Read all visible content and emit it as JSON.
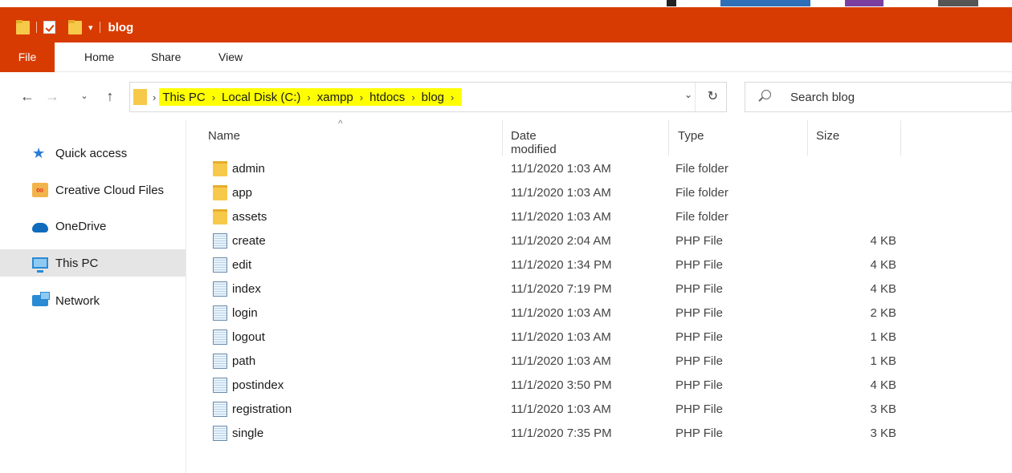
{
  "window": {
    "title": "blog"
  },
  "colors": {
    "accent": "#d83b01",
    "highlight": "#ffff00",
    "selection": "#e5e5e5"
  },
  "ribbon": {
    "tabs": [
      "File",
      "Home",
      "Share",
      "View"
    ]
  },
  "nav": {
    "back_icon": "arrow-left-icon",
    "forward_icon": "arrow-right-icon",
    "recent_icon": "chevron-down-icon",
    "up_icon": "arrow-up-icon"
  },
  "address": {
    "breadcrumbs": [
      "This PC",
      "Local Disk (C:)",
      "xampp",
      "htdocs",
      "blog"
    ]
  },
  "search": {
    "placeholder": "Search blog"
  },
  "sidebar": {
    "items": [
      {
        "label": "Quick access",
        "icon": "star-icon"
      },
      {
        "label": "Creative Cloud Files",
        "icon": "creative-cloud-icon"
      },
      {
        "label": "OneDrive",
        "icon": "cloud-icon"
      },
      {
        "label": "This PC",
        "icon": "computer-icon",
        "selected": true
      },
      {
        "label": "Network",
        "icon": "network-icon"
      }
    ]
  },
  "columns": {
    "name": "Name",
    "date": "Date modified",
    "type": "Type",
    "size": "Size"
  },
  "files": [
    {
      "name": "admin",
      "date": "11/1/2020 1:03 AM",
      "type": "File folder",
      "size": "",
      "kind": "folder"
    },
    {
      "name": "app",
      "date": "11/1/2020 1:03 AM",
      "type": "File folder",
      "size": "",
      "kind": "folder"
    },
    {
      "name": "assets",
      "date": "11/1/2020 1:03 AM",
      "type": "File folder",
      "size": "",
      "kind": "folder"
    },
    {
      "name": "create",
      "date": "11/1/2020 2:04 AM",
      "type": "PHP File",
      "size": "4 KB",
      "kind": "php"
    },
    {
      "name": "edit",
      "date": "11/1/2020 1:34 PM",
      "type": "PHP File",
      "size": "4 KB",
      "kind": "php"
    },
    {
      "name": "index",
      "date": "11/1/2020 7:19 PM",
      "type": "PHP File",
      "size": "4 KB",
      "kind": "php"
    },
    {
      "name": "login",
      "date": "11/1/2020 1:03 AM",
      "type": "PHP File",
      "size": "2 KB",
      "kind": "php"
    },
    {
      "name": "logout",
      "date": "11/1/2020 1:03 AM",
      "type": "PHP File",
      "size": "1 KB",
      "kind": "php"
    },
    {
      "name": "path",
      "date": "11/1/2020 1:03 AM",
      "type": "PHP File",
      "size": "1 KB",
      "kind": "php"
    },
    {
      "name": "postindex",
      "date": "11/1/2020 3:50 PM",
      "type": "PHP File",
      "size": "4 KB",
      "kind": "php"
    },
    {
      "name": "registration",
      "date": "11/1/2020 1:03 AM",
      "type": "PHP File",
      "size": "3 KB",
      "kind": "php"
    },
    {
      "name": "single",
      "date": "11/1/2020 7:35 PM",
      "type": "PHP File",
      "size": "3 KB",
      "kind": "php"
    }
  ]
}
